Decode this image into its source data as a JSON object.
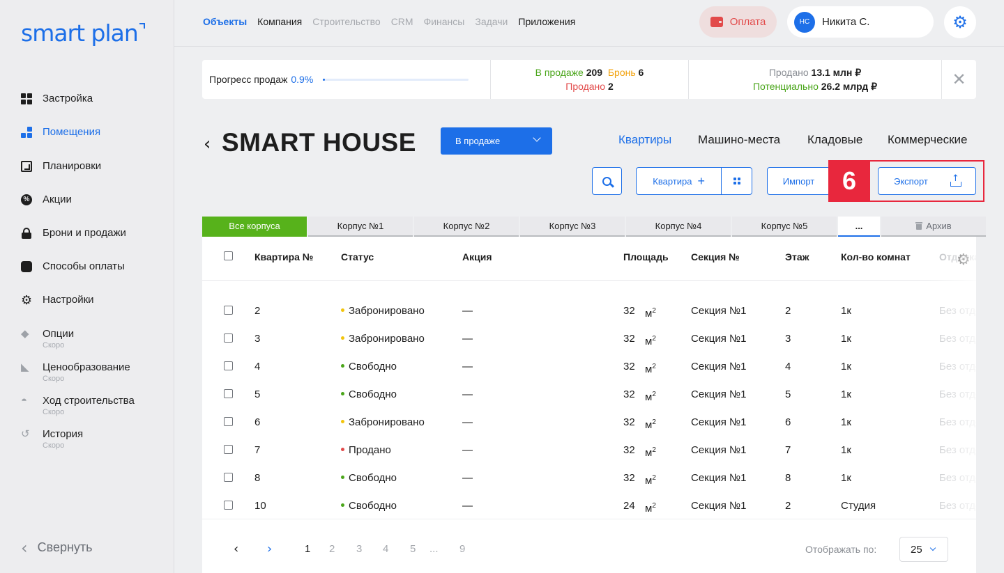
{
  "brand": {
    "logo_text": "smart plan"
  },
  "sidebar": {
    "items": [
      {
        "label": "Застройка",
        "icon": "grid-icon",
        "sub": ""
      },
      {
        "label": "Помещения",
        "icon": "rooms-icon",
        "sub": ""
      },
      {
        "label": "Планировки",
        "icon": "floorplan-icon",
        "sub": ""
      },
      {
        "label": "Акции",
        "icon": "percent-icon",
        "sub": ""
      },
      {
        "label": "Брони и продажи",
        "icon": "lock-icon",
        "sub": ""
      },
      {
        "label": "Способы оплаты",
        "icon": "wallet-icon",
        "sub": ""
      },
      {
        "label": "Настройки",
        "icon": "gear-icon",
        "sub": ""
      },
      {
        "label": "Опции",
        "icon": "diamond-icon",
        "sub": "Скоро"
      },
      {
        "label": "Ценообразование",
        "icon": "tag-icon",
        "sub": "Скоро"
      },
      {
        "label": "Ход строительства",
        "icon": "helmet-icon",
        "sub": "Скоро"
      },
      {
        "label": "История",
        "icon": "history-icon",
        "sub": "Скоро"
      }
    ],
    "active_index": 1,
    "collapse_label": "Свернуть"
  },
  "topnav": {
    "items": [
      "Объекты",
      "Компания",
      "Строительство",
      "CRM",
      "Финансы",
      "Задачи",
      "Приложения"
    ],
    "pay_label": "Оплата",
    "user_initials": "НС",
    "user_name": "Никита С."
  },
  "stats": {
    "progress_label": "Прогресс продаж",
    "progress_value": "0.9%",
    "progress_fraction": 0.009,
    "on_sale_label": "В продаже",
    "on_sale_value": "209",
    "booked_label": "Бронь",
    "booked_value": "6",
    "sold_label": "Продано",
    "sold_value": "2",
    "sold_sum_label": "Продано",
    "sold_sum_value": "13.1 млн ₽",
    "potential_label": "Потенциально",
    "potential_value": "26.2 млрд ₽"
  },
  "project": {
    "title": "SMART HOUSE",
    "status_select": "В продаже",
    "type_tabs": [
      "Квартиры",
      "Машино-места",
      "Кладовые",
      "Коммерческие"
    ]
  },
  "actions": {
    "add_label": "Квартира",
    "import_label": "Импорт",
    "export_label": "Экспорт",
    "step_badge": "6"
  },
  "building_tabs": [
    "Все корпуса",
    "Корпус №1",
    "Корпус №2",
    "Корпус №3",
    "Корпус №4",
    "Корпус №5",
    "...",
    "Архив"
  ],
  "table": {
    "headers": [
      "Квартира №",
      "Статус",
      "Акция",
      "Площадь",
      "Секция №",
      "Этаж",
      "Кол-во комнат",
      "Отделка"
    ],
    "rows": [
      {
        "num": "2",
        "status": "Забронировано",
        "status_color": "#f2c40c",
        "promo": "—",
        "area": "32",
        "unit": "м",
        "unit_sup": "2",
        "section": "Секция №1",
        "floor": "2",
        "rooms": "1к",
        "finish": "Без отделки"
      },
      {
        "num": "3",
        "status": "Забронировано",
        "status_color": "#f2c40c",
        "promo": "—",
        "area": "32",
        "unit": "м",
        "unit_sup": "2",
        "section": "Секция №1",
        "floor": "3",
        "rooms": "1к",
        "finish": "Без отделки"
      },
      {
        "num": "4",
        "status": "Свободно",
        "status_color": "#4aa51a",
        "promo": "—",
        "area": "32",
        "unit": "м",
        "unit_sup": "2",
        "section": "Секция №1",
        "floor": "4",
        "rooms": "1к",
        "finish": "Без отделки"
      },
      {
        "num": "5",
        "status": "Свободно",
        "status_color": "#4aa51a",
        "promo": "—",
        "area": "32",
        "unit": "м",
        "unit_sup": "2",
        "section": "Секция №1",
        "floor": "5",
        "rooms": "1к",
        "finish": "Без отделки"
      },
      {
        "num": "6",
        "status": "Забронировано",
        "status_color": "#f2c40c",
        "promo": "—",
        "area": "32",
        "unit": "м",
        "unit_sup": "2",
        "section": "Секция №1",
        "floor": "6",
        "rooms": "1к",
        "finish": "Без отделки"
      },
      {
        "num": "7",
        "status": "Продано",
        "status_color": "#e24a4a",
        "promo": "—",
        "area": "32",
        "unit": "м",
        "unit_sup": "2",
        "section": "Секция №1",
        "floor": "7",
        "rooms": "1к",
        "finish": "Без отделки"
      },
      {
        "num": "8",
        "status": "Свободно",
        "status_color": "#4aa51a",
        "promo": "—",
        "area": "32",
        "unit": "м",
        "unit_sup": "2",
        "section": "Секция №1",
        "floor": "8",
        "rooms": "1к",
        "finish": "Без отделки"
      },
      {
        "num": "10",
        "status": "Свободно",
        "status_color": "#4aa51a",
        "promo": "—",
        "area": "24",
        "unit": "м",
        "unit_sup": "2",
        "section": "Секция №1",
        "floor": "2",
        "rooms": "Студия",
        "finish": "Без отделки"
      }
    ]
  },
  "pagination": {
    "pages": [
      "1",
      "2",
      "3",
      "4",
      "5",
      "...",
      "9"
    ],
    "current": "1",
    "per_page_label": "Отображать по:",
    "per_page_value": "25"
  },
  "colors": {
    "accent": "#1d6fe8",
    "green": "#57b21b",
    "red": "#e24a4a",
    "orange": "#f2a20c",
    "highlight": "#e8273d"
  }
}
